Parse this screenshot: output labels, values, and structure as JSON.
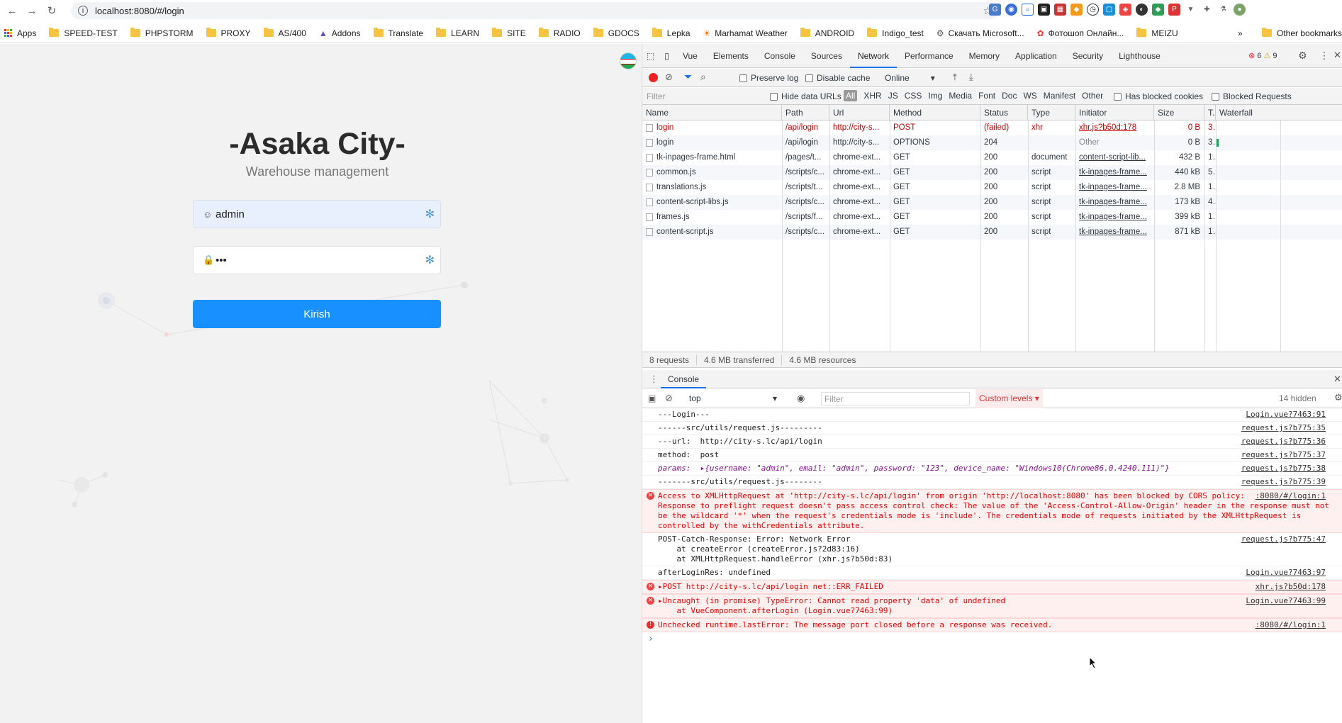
{
  "browser": {
    "url": "localhost:8080/#/login",
    "bookmarks": [
      "Apps",
      "SPEED-TEST",
      "PHPSTORM",
      "PROXY",
      "AS/400",
      "Addons",
      "Translate",
      "LEARN",
      "SITE",
      "RADIO",
      "GDOCS",
      "Lepka",
      "Marhamat Weather",
      "ANDROID",
      "Indigo_test",
      "Скачать Microsoft...",
      "Фотошоп Онлайн...",
      "MEIZU"
    ],
    "other_bookmarks": "Other bookmarks",
    "more": "»"
  },
  "app": {
    "title": "-Asaka City-",
    "subtitle": "Warehouse management",
    "username": "admin",
    "password_mask": "•••",
    "login_label": "Kirish"
  },
  "devtools": {
    "tabs": [
      "Vue",
      "Elements",
      "Console",
      "Sources",
      "Network",
      "Performance",
      "Memory",
      "Application",
      "Security",
      "Lighthouse"
    ],
    "active_tab": "Network",
    "errors": "6",
    "warnings": "9",
    "preserve_log": "Preserve log",
    "disable_cache": "Disable cache",
    "throttle": "Online",
    "filter_placeholder": "Filter",
    "hide_data_urls": "Hide data URLs",
    "type_filters": [
      "All",
      "XHR",
      "JS",
      "CSS",
      "Img",
      "Media",
      "Font",
      "Doc",
      "WS",
      "Manifest",
      "Other"
    ],
    "has_blocked_cookies": "Has blocked cookies",
    "blocked_requests": "Blocked Requests",
    "columns": [
      "Name",
      "Path",
      "Url",
      "Method",
      "Status",
      "Type",
      "Initiator",
      "Size",
      "T..",
      "Waterfall"
    ],
    "rows": [
      {
        "name": "login",
        "path": "/api/login",
        "url": "http://city-s...",
        "method": "POST",
        "status": "(failed)",
        "type": "xhr",
        "initiator": "xhr.js?b50d:178",
        "size": "0 B",
        "time": "3..",
        "failed": true
      },
      {
        "name": "login",
        "path": "/api/login",
        "url": "http://city-s...",
        "method": "OPTIONS",
        "status": "204",
        "type": "",
        "initiator": "Other",
        "size": "0 B",
        "time": "3..",
        "failed": false
      },
      {
        "name": "tk-inpages-frame.html",
        "path": "/pages/t...",
        "url": "chrome-ext...",
        "method": "GET",
        "status": "200",
        "type": "document",
        "initiator": "content-script-lib...",
        "size": "432 B",
        "time": "1..",
        "failed": false
      },
      {
        "name": "common.js",
        "path": "/scripts/c...",
        "url": "chrome-ext...",
        "method": "GET",
        "status": "200",
        "type": "script",
        "initiator": "tk-inpages-frame...",
        "size": "440 kB",
        "time": "5..",
        "failed": false
      },
      {
        "name": "translations.js",
        "path": "/scripts/t...",
        "url": "chrome-ext...",
        "method": "GET",
        "status": "200",
        "type": "script",
        "initiator": "tk-inpages-frame...",
        "size": "2.8 MB",
        "time": "1..",
        "failed": false
      },
      {
        "name": "content-script-libs.js",
        "path": "/scripts/c...",
        "url": "chrome-ext...",
        "method": "GET",
        "status": "200",
        "type": "script",
        "initiator": "tk-inpages-frame...",
        "size": "173 kB",
        "time": "4..",
        "failed": false
      },
      {
        "name": "frames.js",
        "path": "/scripts/f...",
        "url": "chrome-ext...",
        "method": "GET",
        "status": "200",
        "type": "script",
        "initiator": "tk-inpages-frame...",
        "size": "399 kB",
        "time": "1..",
        "failed": false
      },
      {
        "name": "content-script.js",
        "path": "/scripts/c...",
        "url": "chrome-ext...",
        "method": "GET",
        "status": "200",
        "type": "script",
        "initiator": "tk-inpages-frame...",
        "size": "871 kB",
        "time": "1..",
        "failed": false
      }
    ],
    "summary": [
      "8 requests",
      "4.6 MB transferred",
      "4.6 MB resources"
    ],
    "console_tab": "Console",
    "context": "top",
    "console_filter": "Filter",
    "custom_levels": "Custom levels ▾",
    "hidden": "14 hidden",
    "console": [
      {
        "text": "---Login---",
        "src": "Login.vue?7463:91",
        "err": false
      },
      {
        "text": "------src/utils/request.js---------",
        "src": "request.js?b775:35",
        "err": false
      },
      {
        "text": "---url:  http://city-s.lc/api/login",
        "src": "request.js?b775:36",
        "err": false
      },
      {
        "text": "method:  post",
        "src": "request.js?b775:37",
        "err": false
      },
      {
        "text": "params:  ▸{username: \"admin\", email: \"admin\", password: \"123\", device_name: \"Windows10(Chrome86.0.4240.111)\"}",
        "src": "request.js?b775:38",
        "err": false
      },
      {
        "text": "-------src/utils/request.js--------",
        "src": "request.js?b775:39",
        "err": false
      },
      {
        "text": "Access to XMLHttpRequest at 'http://city-s.lc/api/login' from origin 'http://localhost:8080' has been blocked by CORS policy:\nResponse to preflight request doesn't pass access control check: The value of the 'Access-Control-Allow-Origin' header in the response must not\nbe the wildcard '*' when the request's credentials mode is 'include'. The credentials mode of requests initiated by the XMLHttpRequest is\ncontrolled by the withCredentials attribute.",
        "src": ":8080/#/login:1",
        "err": true
      },
      {
        "text": "POST-Catch-Response: Error: Network Error\n    at createError (createError.js?2d83:16)\n    at XMLHttpRequest.handleError (xhr.js?b50d:83)",
        "src": "request.js?b775:47",
        "err": false
      },
      {
        "text": "afterLoginRes: undefined",
        "src": "Login.vue?7463:97",
        "err": false
      },
      {
        "text": "▸POST http://city-s.lc/api/login net::ERR_FAILED",
        "src": "xhr.js?b50d:178",
        "err": true
      },
      {
        "text": "▸Uncaught (in promise) TypeError: Cannot read property 'data' of undefined\n    at VueComponent.afterLogin (Login.vue?7463:99)",
        "src": "Login.vue?7463:99",
        "err": true
      },
      {
        "text": "Unchecked runtime.lastError: The message port closed before a response was received.",
        "src": ":8080/#/login:1",
        "err": true
      }
    ],
    "prompt": "›"
  },
  "colors": {
    "accent": "#1890ff",
    "error": "#e00",
    "link": "#1a73e8"
  }
}
